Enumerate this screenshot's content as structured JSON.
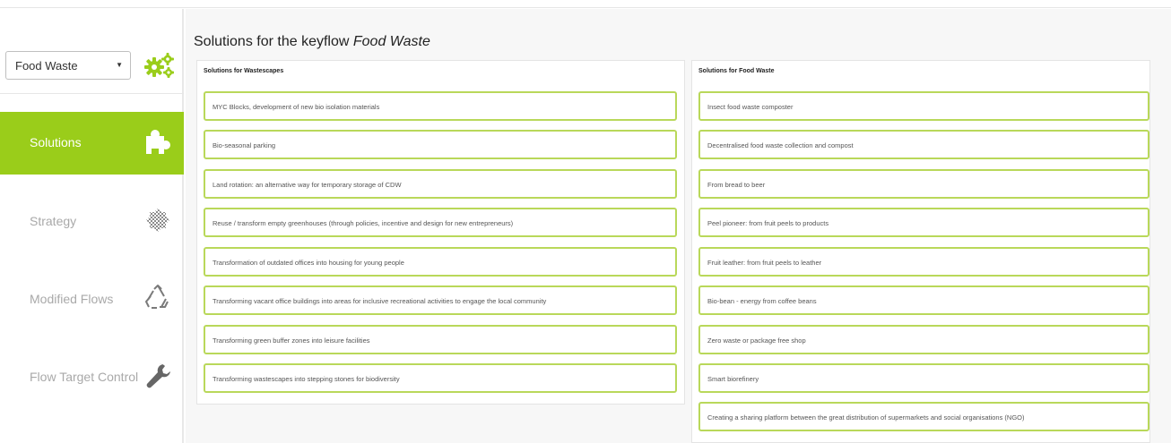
{
  "keyflow_select": {
    "value": "Food Waste"
  },
  "sidebar": {
    "items": [
      {
        "label": "Solutions",
        "icon": "puzzle-icon",
        "active": true
      },
      {
        "label": "Strategy",
        "icon": "checkerboard-icon",
        "active": false
      },
      {
        "label": "Modified Flows",
        "icon": "recycle-icon",
        "active": false
      },
      {
        "label": "Flow Target Control",
        "icon": "wrench-icon",
        "active": false
      }
    ]
  },
  "header": {
    "title_prefix": "Solutions for the keyflow",
    "title_keyflow": "Food Waste"
  },
  "panels": {
    "left": {
      "title": "Solutions for Wastescapes",
      "items": [
        "MYC Blocks, development of new bio isolation materials",
        "Bio-seasonal parking",
        "Land rotation: an alternative way for temporary storage of CDW",
        "Reuse / transform empty greenhouses (through policies, incentive and design for new entrepreneurs)",
        "Transformation of outdated offices into housing for young people",
        "Transforming vacant office buildings into areas for inclusive recreational activities to engage the local community",
        "Transforming green buffer zones into leisure facilities",
        "Transforming wastescapes into stepping stones for biodiversity"
      ]
    },
    "right": {
      "title": "Solutions for Food Waste",
      "items": [
        "Insect food waste composter",
        "Decentralised food waste collection and compost",
        "From bread to beer",
        "Peel pioneer: from fruit peels to products",
        "Fruit leather: from fruit peels to leather",
        "Bio-bean - energy from coffee beans",
        "Zero waste or package free shop",
        "Smart biorefinery",
        "Creating a sharing platform between the great distribution of supermarkets and social organisations (NGO)"
      ]
    }
  },
  "colors": {
    "accent": "#9acd1a",
    "item_border": "#b9d85a",
    "nav_inactive_text": "#a9a9a9",
    "main_background": "#f7f7f7"
  }
}
